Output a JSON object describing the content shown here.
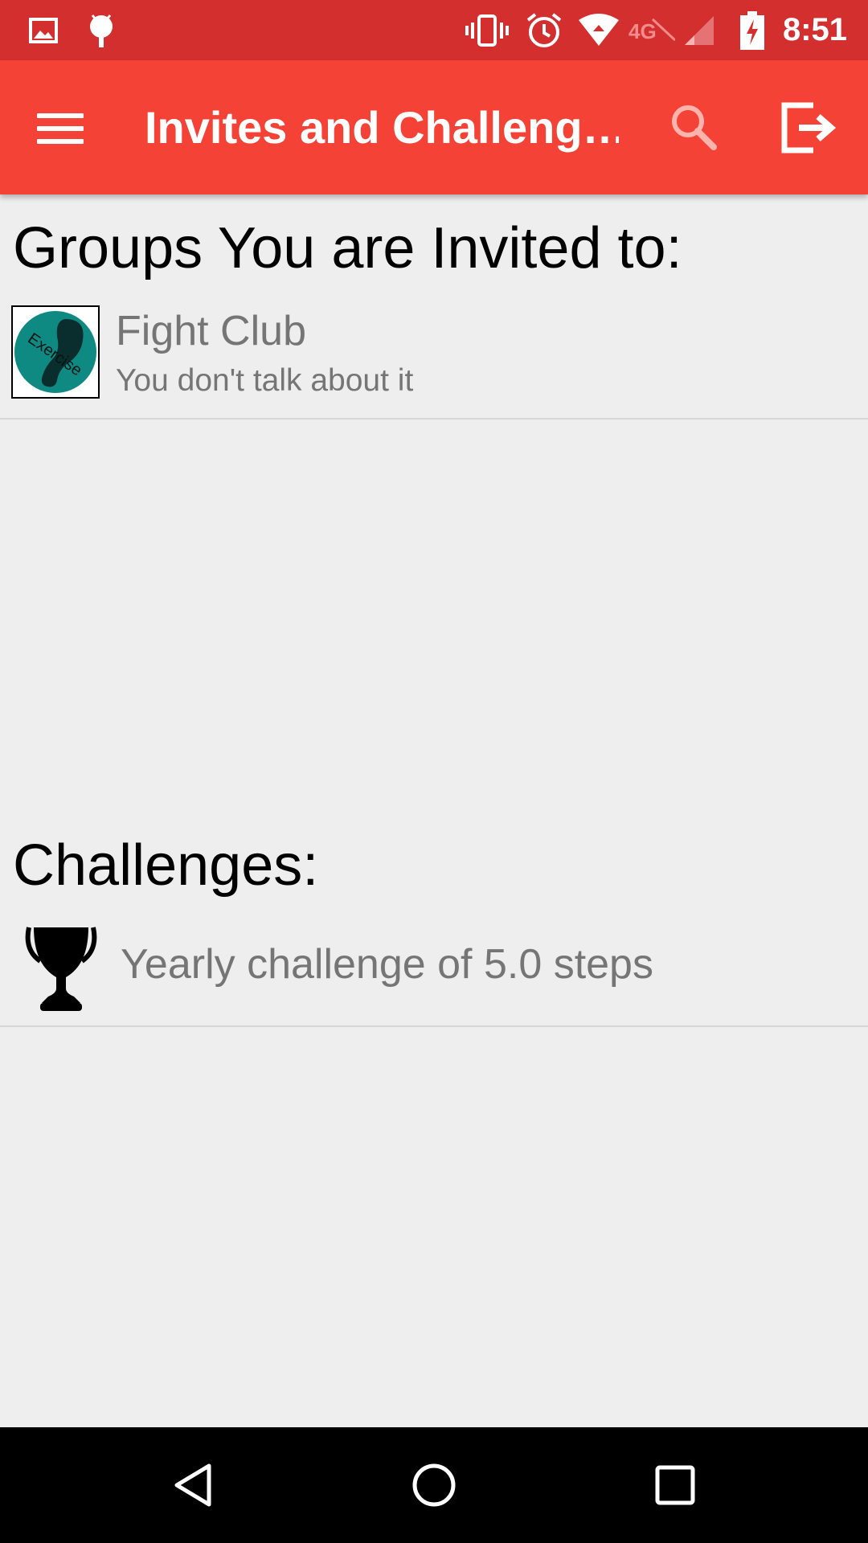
{
  "status_bar": {
    "time": "8:51",
    "left_icons": [
      "image-icon",
      "android-icon"
    ],
    "right_icons": [
      "vibrate-icon",
      "alarm-icon",
      "wifi-icon",
      "data-4g-icon",
      "signal-icon",
      "battery-charging-icon"
    ],
    "color": "#d32f2f"
  },
  "app_bar": {
    "title": "Invites and Challeng…",
    "color": "#f44336",
    "menu_icon": "menu-icon",
    "search_icon": "search-icon",
    "logout_icon": "logout-icon"
  },
  "groups_section": {
    "title": "Groups You are Invited to:",
    "items": [
      {
        "name": "Fight Club",
        "description": "You don't talk about it",
        "avatar_text": "Exercise"
      }
    ]
  },
  "challenges_section": {
    "title": "Challenges:",
    "items": [
      {
        "text": "Yearly challenge of 5.0 steps",
        "icon": "trophy-icon"
      }
    ]
  },
  "nav_bar": {
    "buttons": [
      "back-icon",
      "home-icon",
      "recents-icon"
    ]
  }
}
